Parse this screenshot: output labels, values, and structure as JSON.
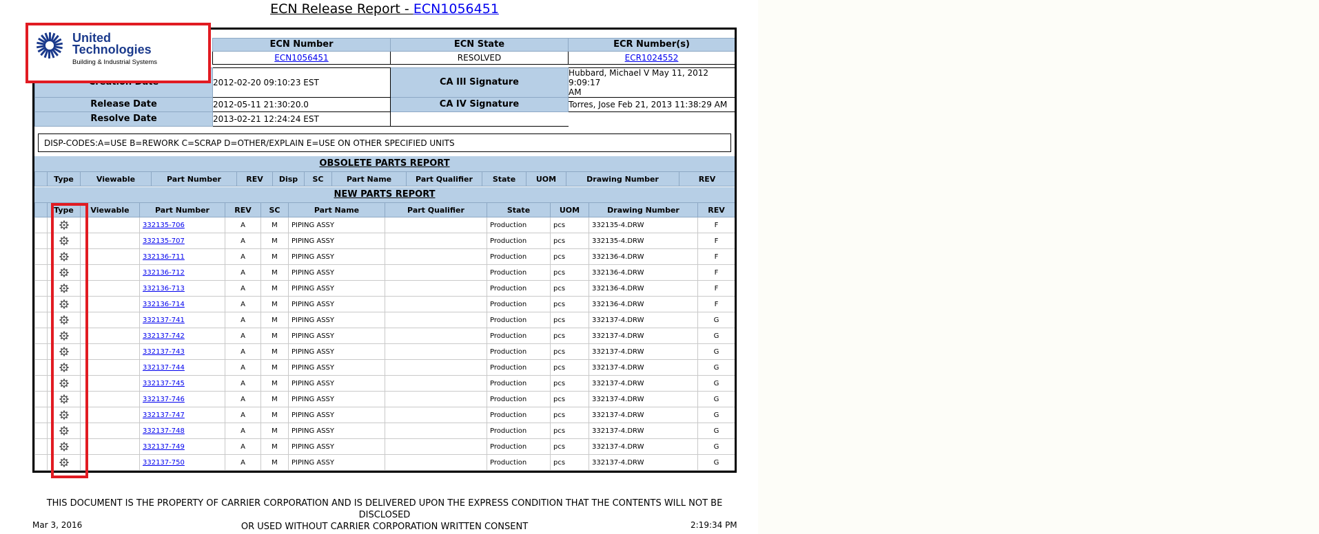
{
  "report": {
    "title_prefix": "ECN Release Report - ",
    "title_link": "ECN1056451"
  },
  "logo": {
    "line1": "United",
    "line2": "Technologies",
    "line3": "Building & Industrial Systems"
  },
  "header": {
    "ecn_number_label": "ECN Number",
    "ecn_state_label": "ECN State",
    "ecr_numbers_label": "ECR Number(s)",
    "ecn_number_value": "ECN1056451",
    "ecn_state_value": "RESOLVED",
    "ecr_number_value": "ECR1024552",
    "creation_date_label": "Creation Date",
    "creation_date_value": "2012-02-20 09:10:23 EST",
    "ca3_label": "CA III Signature",
    "ca3_value_line1": "Hubbard, Michael V May 11, 2012 9:09:17",
    "ca3_value_line2": "AM",
    "release_date_label": "Release Date",
    "release_date_value": "2012-05-11 21:30:20.0",
    "ca4_label": "CA IV Signature",
    "ca4_value": "Torres, Jose Feb 21, 2013 11:38:29 AM",
    "resolve_date_label": "Resolve Date",
    "resolve_date_value": "2013-02-21 12:24:24 EST"
  },
  "disp_codes": "DISP-CODES:A=USE  B=REWORK C=SCRAP D=OTHER/EXPLAIN E=USE ON OTHER SPECIFIED UNITS",
  "obsolete": {
    "title": "OBSOLETE PARTS REPORT",
    "columns": [
      "Type",
      "Viewable",
      "Part Number",
      "REV",
      "Disp",
      "SC",
      "Part Name",
      "Part Qualifier",
      "State",
      "UOM",
      "Drawing Number",
      "REV"
    ]
  },
  "new_parts": {
    "title": "NEW PARTS REPORT",
    "columns": [
      "Type",
      "Viewable",
      "Part Number",
      "REV",
      "SC",
      "Part Name",
      "Part Qualifier",
      "State",
      "UOM",
      "Drawing Number",
      "REV"
    ],
    "rows": [
      {
        "part": "332135-706",
        "rev": "A",
        "sc": "M",
        "name": "PIPING ASSY",
        "qual": "",
        "state": "Production",
        "uom": "pcs",
        "drawing": "332135-4.DRW",
        "drev": "F"
      },
      {
        "part": "332135-707",
        "rev": "A",
        "sc": "M",
        "name": "PIPING ASSY",
        "qual": "",
        "state": "Production",
        "uom": "pcs",
        "drawing": "332135-4.DRW",
        "drev": "F"
      },
      {
        "part": "332136-711",
        "rev": "A",
        "sc": "M",
        "name": "PIPING ASSY",
        "qual": "",
        "state": "Production",
        "uom": "pcs",
        "drawing": "332136-4.DRW",
        "drev": "F"
      },
      {
        "part": "332136-712",
        "rev": "A",
        "sc": "M",
        "name": "PIPING ASSY",
        "qual": "",
        "state": "Production",
        "uom": "pcs",
        "drawing": "332136-4.DRW",
        "drev": "F"
      },
      {
        "part": "332136-713",
        "rev": "A",
        "sc": "M",
        "name": "PIPING ASSY",
        "qual": "",
        "state": "Production",
        "uom": "pcs",
        "drawing": "332136-4.DRW",
        "drev": "F"
      },
      {
        "part": "332136-714",
        "rev": "A",
        "sc": "M",
        "name": "PIPING ASSY",
        "qual": "",
        "state": "Production",
        "uom": "pcs",
        "drawing": "332136-4.DRW",
        "drev": "F"
      },
      {
        "part": "332137-741",
        "rev": "A",
        "sc": "M",
        "name": "PIPING ASSY",
        "qual": "",
        "state": "Production",
        "uom": "pcs",
        "drawing": "332137-4.DRW",
        "drev": "G"
      },
      {
        "part": "332137-742",
        "rev": "A",
        "sc": "M",
        "name": "PIPING ASSY",
        "qual": "",
        "state": "Production",
        "uom": "pcs",
        "drawing": "332137-4.DRW",
        "drev": "G"
      },
      {
        "part": "332137-743",
        "rev": "A",
        "sc": "M",
        "name": "PIPING ASSY",
        "qual": "",
        "state": "Production",
        "uom": "pcs",
        "drawing": "332137-4.DRW",
        "drev": "G"
      },
      {
        "part": "332137-744",
        "rev": "A",
        "sc": "M",
        "name": "PIPING ASSY",
        "qual": "",
        "state": "Production",
        "uom": "pcs",
        "drawing": "332137-4.DRW",
        "drev": "G"
      },
      {
        "part": "332137-745",
        "rev": "A",
        "sc": "M",
        "name": "PIPING ASSY",
        "qual": "",
        "state": "Production",
        "uom": "pcs",
        "drawing": "332137-4.DRW",
        "drev": "G"
      },
      {
        "part": "332137-746",
        "rev": "A",
        "sc": "M",
        "name": "PIPING ASSY",
        "qual": "",
        "state": "Production",
        "uom": "pcs",
        "drawing": "332137-4.DRW",
        "drev": "G"
      },
      {
        "part": "332137-747",
        "rev": "A",
        "sc": "M",
        "name": "PIPING ASSY",
        "qual": "",
        "state": "Production",
        "uom": "pcs",
        "drawing": "332137-4.DRW",
        "drev": "G"
      },
      {
        "part": "332137-748",
        "rev": "A",
        "sc": "M",
        "name": "PIPING ASSY",
        "qual": "",
        "state": "Production",
        "uom": "pcs",
        "drawing": "332137-4.DRW",
        "drev": "G"
      },
      {
        "part": "332137-749",
        "rev": "A",
        "sc": "M",
        "name": "PIPING ASSY",
        "qual": "",
        "state": "Production",
        "uom": "pcs",
        "drawing": "332137-4.DRW",
        "drev": "G"
      },
      {
        "part": "332137-750",
        "rev": "A",
        "sc": "M",
        "name": "PIPING ASSY",
        "qual": "",
        "state": "Production",
        "uom": "pcs",
        "drawing": "332137-4.DRW",
        "drev": "G"
      }
    ]
  },
  "footer": {
    "line1": "THIS DOCUMENT IS THE PROPERTY OF CARRIER CORPORATION AND IS DELIVERED UPON THE EXPRESS CONDITION THAT THE CONTENTS WILL NOT BE DISCLOSED",
    "line2": "OR USED WITHOUT CARRIER CORPORATION WRITTEN CONSENT",
    "print_date": "Mar 3, 2016",
    "print_time": "2:19:34 PM"
  },
  "colors": {
    "header_fill": "#b7cfe6",
    "highlight": "#e11b22",
    "logo_blue": "#1b3a8c",
    "link": "#0000ee"
  },
  "icons": {
    "type_column": "gear-icon",
    "logo": "ut-logo-icon"
  }
}
